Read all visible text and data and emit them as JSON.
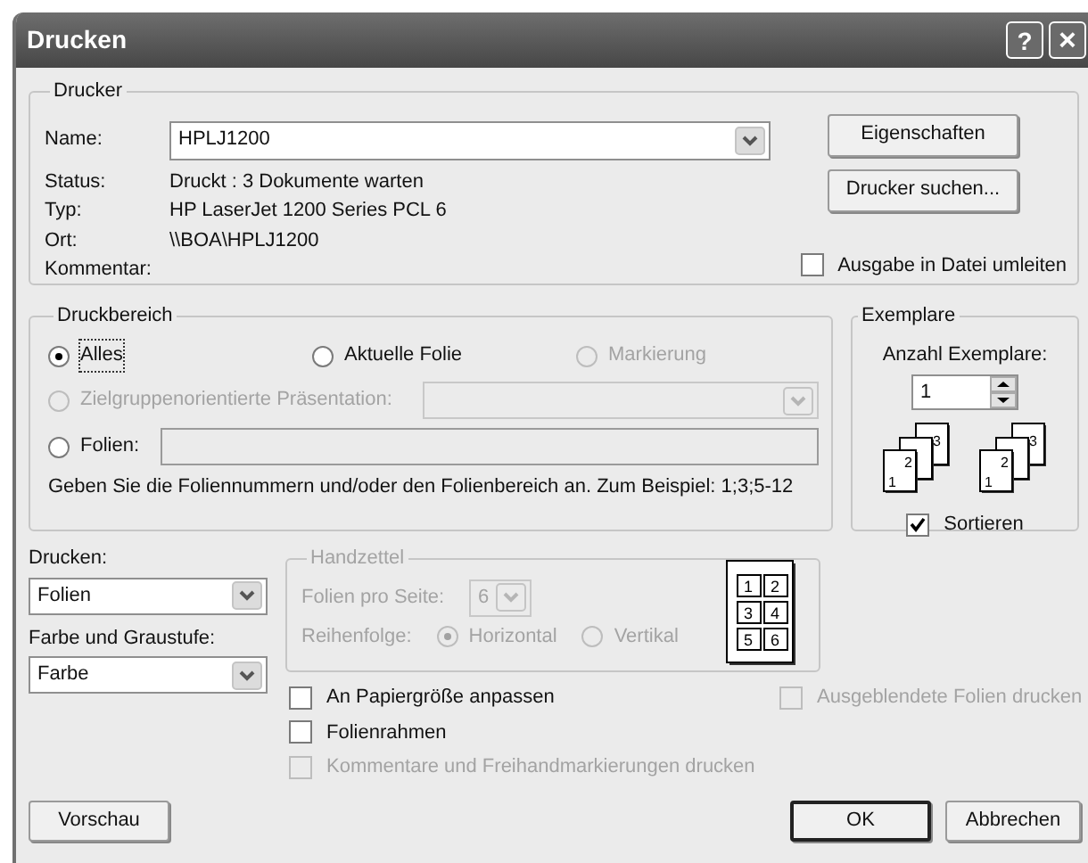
{
  "window": {
    "title": "Drucken",
    "help_button": "?",
    "close_button": "×"
  },
  "printer": {
    "legend": "Drucker",
    "name_label": "Name:",
    "name_value": "HPLJ1200",
    "info": [
      {
        "label": "Status:",
        "value": "Druckt : 3 Dokumente warten"
      },
      {
        "label": "Typ:",
        "value": "HP LaserJet 1200 Series PCL 6"
      },
      {
        "label": "Ort:",
        "value": "\\\\BOA\\HPLJ1200"
      },
      {
        "label": "Kommentar:"
      }
    ],
    "buttons": [
      "Eigenschaften",
      "Drucker suchen..."
    ],
    "print_to_file": {
      "label": "Ausgabe in Datei umleiten",
      "checked": false
    }
  },
  "range": {
    "legend": "Druckbereich",
    "options": [
      {
        "kind": "simple",
        "label": "Alles",
        "selected": true,
        "disabled": false
      },
      {
        "kind": "simple",
        "label": "Aktuelle Folie",
        "selected": false,
        "disabled": false
      },
      {
        "kind": "simple",
        "label": "Markierung",
        "selected": false,
        "disabled": true
      },
      {
        "kind": "custom_show",
        "label": "Zielgruppenorientierte Präsentation:",
        "selected": false,
        "disabled": true
      },
      {
        "kind": "slides",
        "label": "Folien:",
        "selected": false,
        "disabled": false
      }
    ],
    "hint": "Geben Sie die Foliennummern und/oder den Folienbereich an. Zum Beispiel: 1;3;5-12"
  },
  "copies": {
    "legend": "Exemplare",
    "label": "Anzahl Exemplare:",
    "value": "1",
    "stacks": [
      [
        "1",
        "2",
        "3"
      ],
      [
        "1",
        "2",
        "3"
      ]
    ],
    "collate": {
      "label": "Sortieren",
      "checked": true
    }
  },
  "print_what": {
    "label": "Drucken:",
    "value": "Folien"
  },
  "color_mode": {
    "label": "Farbe und Graustufe:",
    "value": "Farbe"
  },
  "handouts": {
    "legend": "Handzettel",
    "disabled": true,
    "per_page_label": "Folien pro Seite:",
    "per_page": "6",
    "order_label": "Reihenfolge:",
    "order_options": [
      {
        "label": "Horizontal",
        "selected": true
      },
      {
        "label": "Vertikal",
        "selected": false
      }
    ],
    "preview_numbers": [
      "1",
      "2",
      "3",
      "4",
      "5",
      "6"
    ]
  },
  "options": [
    {
      "label": "An Papiergröße anpassen",
      "checked": false,
      "disabled": false
    },
    {
      "label": "Folienrahmen",
      "checked": false,
      "disabled": false
    },
    {
      "label": "Kommentare und Freihandmarkierungen drucken",
      "checked": false,
      "disabled": true
    },
    {
      "label": "Ausgeblendete Folien drucken",
      "checked": false,
      "disabled": true
    }
  ],
  "footer_buttons": [
    {
      "label": "Vorschau",
      "default": false
    },
    {
      "label": "OK",
      "default": true
    },
    {
      "label": "Abbrechen",
      "default": false
    }
  ]
}
